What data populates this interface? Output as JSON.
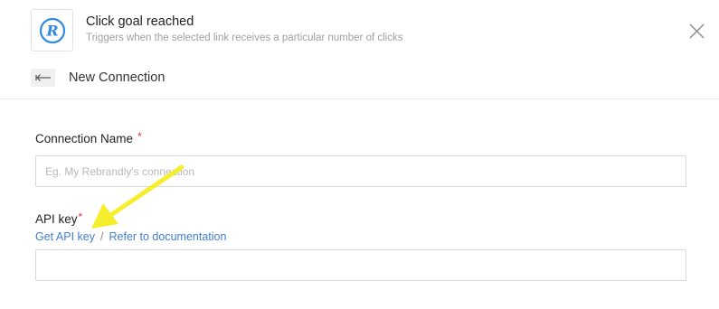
{
  "header": {
    "title": "Click goal reached",
    "description": "Triggers when the selected link receives a particular number of clicks",
    "logo_icon": "rebrandly-r-logo-icon",
    "close_icon": "close-icon"
  },
  "subheader": {
    "back_icon": "back-arrow-icon",
    "title": "New Connection"
  },
  "form": {
    "connection_name": {
      "label": "Connection Name",
      "required_marker": "*",
      "placeholder": "Eg. My Rebrandly's connection",
      "value": ""
    },
    "api_key": {
      "label": "API key",
      "required_marker": "*",
      "value": "",
      "get_key_link": "Get API key",
      "separator": "/",
      "docs_link": "Refer to documentation"
    }
  },
  "colors": {
    "brand": "#2f8ae0",
    "link": "#3f7fcf",
    "required": "#e53935",
    "annotation_arrow": "#f5ee2e"
  }
}
